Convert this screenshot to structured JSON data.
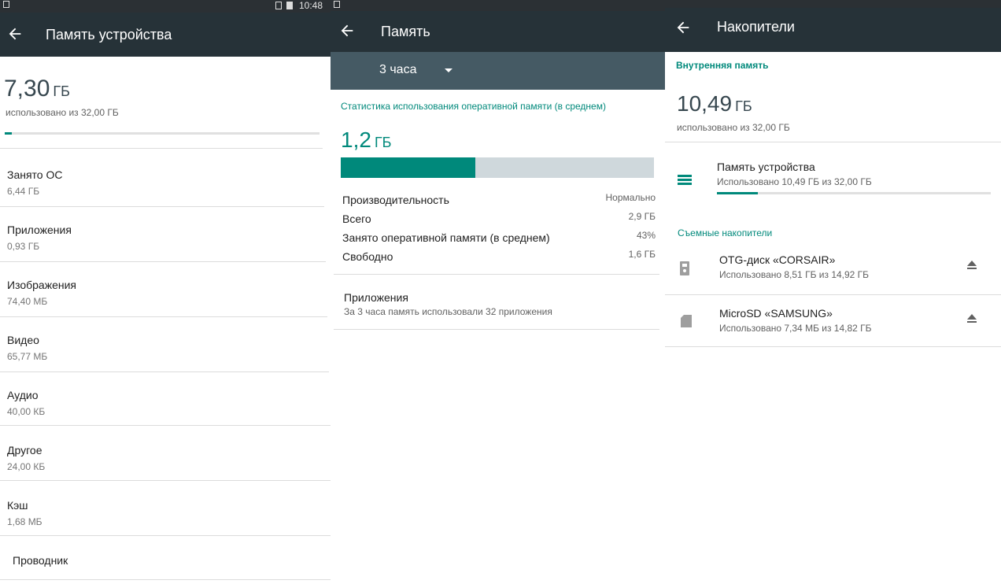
{
  "panel1": {
    "status_time": "10:48",
    "title": "Память устройства",
    "used_value": "7,30",
    "used_unit": "ГБ",
    "used_caption": "использовано из 32,00 ГБ",
    "usage_fraction": 0.023,
    "items": [
      {
        "label": "Занято ОС",
        "value": "6,44 ГБ"
      },
      {
        "label": "Приложения",
        "value": "0,93 ГБ"
      },
      {
        "label": "Изображения",
        "value": "74,40 МБ"
      },
      {
        "label": "Видео",
        "value": "65,77 МБ"
      },
      {
        "label": "Аудио",
        "value": "40,00 КБ"
      },
      {
        "label": "Другое",
        "value": "24,00 КБ"
      },
      {
        "label": "Кэш",
        "value": "1,68 МБ"
      },
      {
        "label": "Проводник",
        "value": ""
      }
    ]
  },
  "panel2": {
    "title": "Память",
    "period": "3 часа",
    "stats_heading": "Статистика использования оперативной памяти (в среднем)",
    "ram_value": "1,2",
    "ram_unit": "ГБ",
    "ram_fraction": 0.43,
    "stats": [
      {
        "label": "Производительность",
        "value": "Нормально"
      },
      {
        "label": "Всего",
        "value": "2,9 ГБ"
      },
      {
        "label": "Занято оперативной памяти (в среднем)",
        "value": "43%"
      },
      {
        "label": "Свободно",
        "value": "1,6 ГБ"
      }
    ],
    "apps_title": "Приложения",
    "apps_caption": "За 3 часа память использовали 32 приложения"
  },
  "panel3": {
    "title": "Накопители",
    "internal_heading": "Внутренняя память",
    "used_value": "10,49",
    "used_unit": "ГБ",
    "used_caption": "использовано из 32,00 ГБ",
    "device": {
      "title": "Память устройства",
      "caption": "Использовано 10,49 ГБ из 32,00 ГБ",
      "fraction": 0.15
    },
    "removable_heading": "Съемные накопители",
    "removable": [
      {
        "title": "OTG-диск «CORSAIR»",
        "caption": "Использовано 8,51 ГБ из 14,92 ГБ"
      },
      {
        "title": "MicroSD «SAMSUNG»",
        "caption": "Использовано 7,34 МБ из 14,82 ГБ"
      }
    ]
  },
  "colors": {
    "accent": "#00897b",
    "toolbar": "#263238",
    "spinner": "#455a64"
  }
}
